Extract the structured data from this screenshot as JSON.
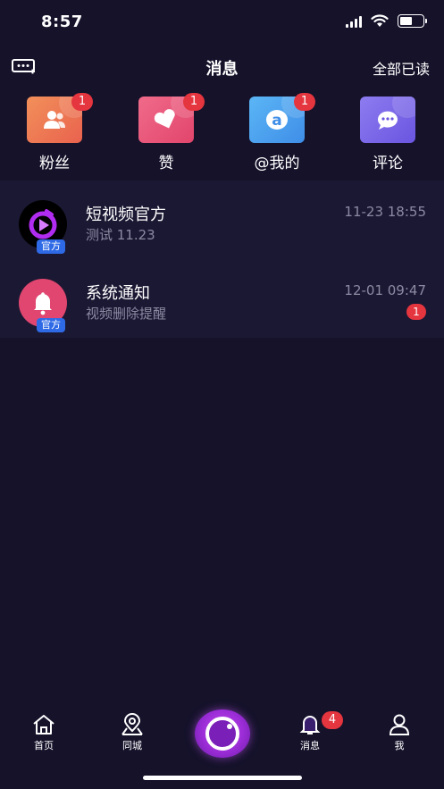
{
  "status_bar": {
    "time": "8:57"
  },
  "header": {
    "title": "消息",
    "mark_all_read": "全部已读",
    "left_icon": "chat-dots-icon"
  },
  "categories": [
    {
      "label": "粉丝",
      "badge": "1",
      "icon": "fans-icon",
      "color_from": "#f2905a",
      "color_to": "#e9624e"
    },
    {
      "label": "赞",
      "badge": "1",
      "icon": "heart-icon",
      "color_from": "#f06b8a",
      "color_to": "#e2456c"
    },
    {
      "label": "@我的",
      "badge": "1",
      "icon": "at-icon",
      "color_from": "#5bb6f5",
      "color_to": "#3f8ee8"
    },
    {
      "label": "评论",
      "badge": "",
      "icon": "comment-icon",
      "color_from": "#8d7cf0",
      "color_to": "#6a55e0"
    }
  ],
  "messages": [
    {
      "title": "短视频官方",
      "subtitle": "测试 11.23",
      "time": "11-23 18:55",
      "tag": "官方",
      "icon": "play-logo-icon",
      "badge": ""
    },
    {
      "title": "系统通知",
      "subtitle": "视频删除提醒",
      "time": "12-01 09:47",
      "tag": "官方",
      "icon": "bell-icon",
      "badge": "1"
    }
  ],
  "tabbar": {
    "home": "首页",
    "city": "同城",
    "messages": "消息",
    "me": "我",
    "messages_badge": "4"
  },
  "colors": {
    "background": "#15122a",
    "list_background": "#1b1833",
    "badge": "#e5353e",
    "official_tag": "#2f6ae6",
    "accent_purple": "#9a2cd6"
  }
}
